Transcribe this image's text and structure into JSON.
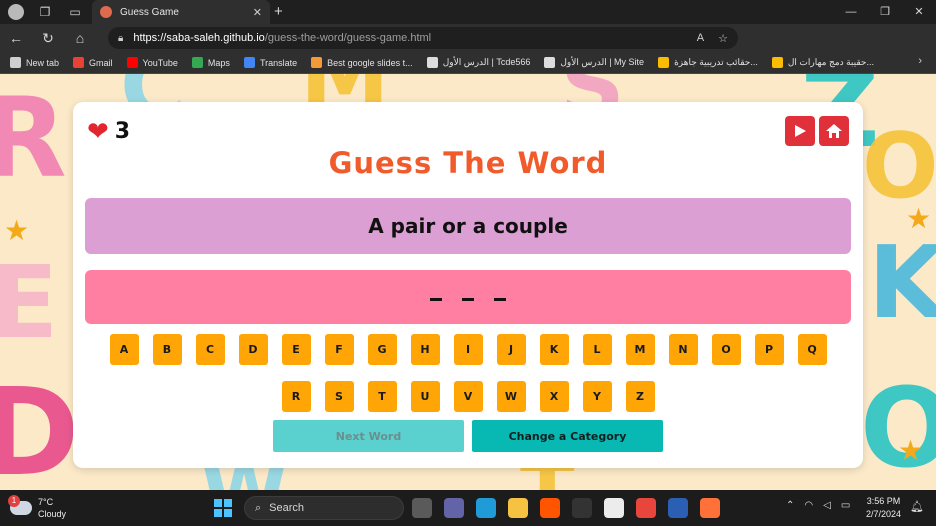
{
  "browser": {
    "tab_title": "Guess Game",
    "url_host": "https://saba-saleh.github.io",
    "url_path": "/guess-the-word/guess-game.html",
    "bookmarks": [
      {
        "label": "New tab",
        "color": "#cfcfcf"
      },
      {
        "label": "Gmail",
        "color": "#e94235"
      },
      {
        "label": "YouTube",
        "color": "#ff0000"
      },
      {
        "label": "Maps",
        "color": "#34a853"
      },
      {
        "label": "Translate",
        "color": "#4285f4"
      },
      {
        "label": "Best google slides t...",
        "color": "#f29b38"
      },
      {
        "label": "الدرس الأول | Tcde566",
        "color": "#dddddd"
      },
      {
        "label": "الدرس الأول | My Site",
        "color": "#dddddd"
      },
      {
        "label": "حقائب تدريبية جاهزة...",
        "color": "#fbbc04"
      },
      {
        "label": "حقيبة دمج مهارات ال...",
        "color": "#fbbc04"
      }
    ]
  },
  "game": {
    "lives": "3",
    "title": "Guess The Word",
    "hint": "A pair or a couple",
    "blanks": 3,
    "keys_row1": [
      "A",
      "B",
      "C",
      "D",
      "E",
      "F",
      "G",
      "H",
      "I",
      "J",
      "K",
      "L",
      "M",
      "N",
      "O",
      "P",
      "Q"
    ],
    "keys_row2": [
      "R",
      "S",
      "T",
      "U",
      "V",
      "W",
      "X",
      "Y",
      "Z"
    ],
    "next_label": "Next Word",
    "category_label": "Change a Category",
    "colors": {
      "title": "#f15a2b",
      "hint_bg": "#dc9fd3",
      "blanks_bg": "#ff7fa3",
      "key_bg": "#ffa606",
      "next_bg": "#5ad1cf",
      "category_bg": "#07b8b3",
      "heart": "#e2262f"
    }
  },
  "taskbar": {
    "temp": "7°C",
    "condition": "Cloudy",
    "weather_badge": "1",
    "search_placeholder": "Search",
    "time": "3:56 PM",
    "date": "2/7/2024"
  }
}
